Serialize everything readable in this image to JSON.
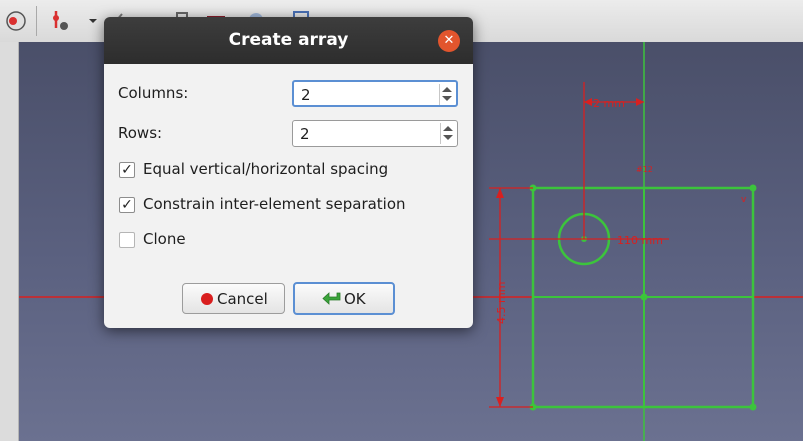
{
  "toolbar": {
    "icons": [
      "sketch-icon",
      "constraint-icon",
      "dropdown-arrow-icon",
      "edit-icon",
      "tool-icon",
      "array-icon",
      "view-icon",
      "grid-icon"
    ]
  },
  "viewport": {
    "dimensions": [
      {
        "text": "2 mm"
      },
      {
        "text": "110 mm"
      },
      {
        "text": "4.5 mm"
      }
    ],
    "sketch_color": "#3cc43c",
    "axis_color": "#d82020"
  },
  "dialog": {
    "title": "Create array",
    "columns_label": "Columns:",
    "columns_value": "2",
    "rows_label": "Rows:",
    "rows_value": "2",
    "equal_spacing_label": "Equal vertical/horizontal spacing",
    "equal_spacing_checked": true,
    "constrain_label": "Constrain inter-element separation",
    "constrain_checked": true,
    "clone_label": "Clone",
    "clone_checked": false,
    "cancel_label": "Cancel",
    "ok_label": "OK"
  }
}
